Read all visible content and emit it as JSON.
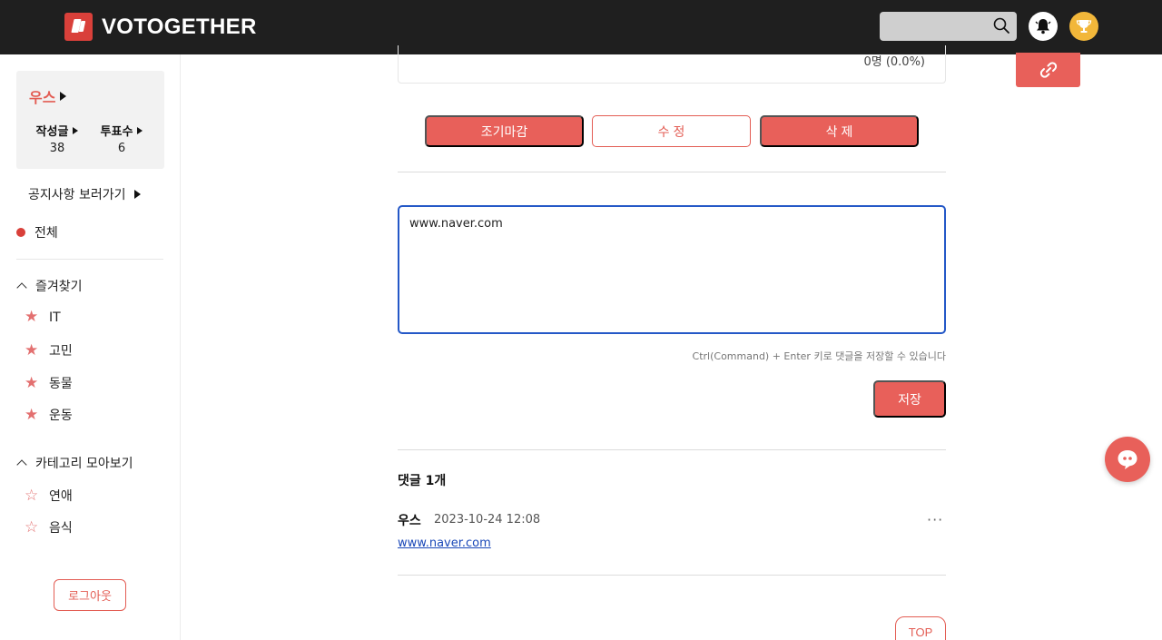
{
  "header": {
    "brand": "VOTOGETHER",
    "search_placeholder": ""
  },
  "sidebar": {
    "profile": {
      "name": "우스",
      "posts_label": "작성글",
      "posts_count": "38",
      "votes_label": "투표수",
      "votes_count": "6"
    },
    "notice_link": "공지사항 보러가기",
    "all_label": "전체",
    "favorites": {
      "title": "즐겨찾기",
      "items": [
        {
          "label": "IT"
        },
        {
          "label": "고민"
        },
        {
          "label": "동물"
        },
        {
          "label": "운동"
        }
      ]
    },
    "categories": {
      "title": "카테고리 모아보기",
      "items": [
        {
          "label": "연애"
        },
        {
          "label": "음식"
        }
      ]
    },
    "logout_label": "로그아웃"
  },
  "main": {
    "result_text": "0명 (0.0%)",
    "actions": {
      "early_close": "조기마감",
      "edit": "수 정",
      "delete": "삭 제"
    },
    "comment_input_value": "www.naver.com",
    "hint": "Ctrl(Command) + Enter 키로 댓글을 저장할 수 있습니다",
    "save_label": "저장",
    "comment_count": "댓글 1개",
    "comments": [
      {
        "author": "우스",
        "date": "2023-10-24 12:08",
        "content": "www.naver.com"
      }
    ],
    "more_icon": "···",
    "top_label": "TOP"
  },
  "colors": {
    "accent": "#e8605a",
    "header_bg": "#1f1f1f",
    "focus_border": "#2458c7",
    "trophy": "#f2b73a"
  }
}
